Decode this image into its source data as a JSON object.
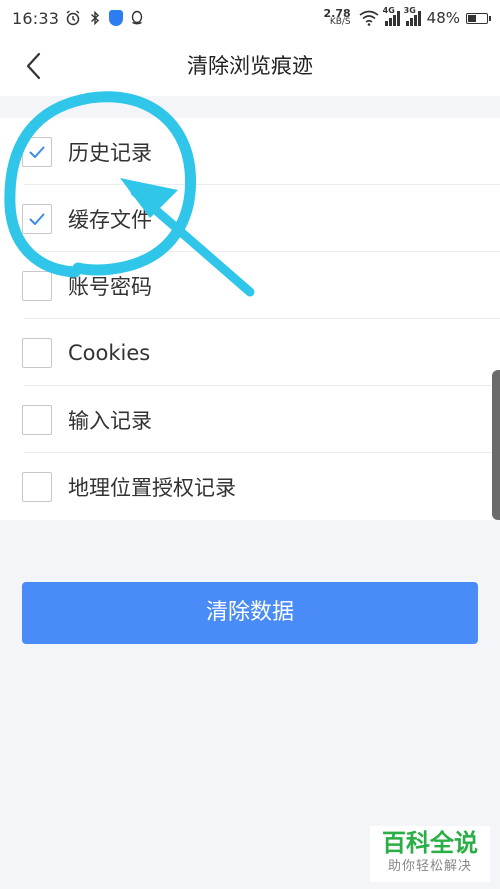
{
  "status_bar": {
    "time": "16:33",
    "net_speed_value": "2.78",
    "net_speed_unit": "KB/S",
    "signal1_tag": "4G",
    "signal2_tag": "3G",
    "battery_text": "48%",
    "battery_level": 0.48
  },
  "header": {
    "title": "清除浏览痕迹"
  },
  "options": [
    {
      "label": "历史记录",
      "checked": true
    },
    {
      "label": "缓存文件",
      "checked": true
    },
    {
      "label": "账号密码",
      "checked": false
    },
    {
      "label": "Cookies",
      "checked": false
    },
    {
      "label": "输入记录",
      "checked": false
    },
    {
      "label": "地理位置授权记录",
      "checked": false
    }
  ],
  "clear_button": {
    "label": "清除数据"
  },
  "watermark": {
    "title": "百科全说",
    "subtitle": "助你轻松解决"
  },
  "colors": {
    "accent": "#4a8cf7",
    "check": "#3b8be8",
    "annotation": "#2fc6ea",
    "watermark": "#2aae45"
  },
  "icons": {
    "alarm": "alarm-icon",
    "bluetooth": "bluetooth-icon",
    "shield": "shield-icon",
    "qq": "qq-icon",
    "wifi": "wifi-icon",
    "back": "chevron-left-icon",
    "check": "check-icon"
  }
}
